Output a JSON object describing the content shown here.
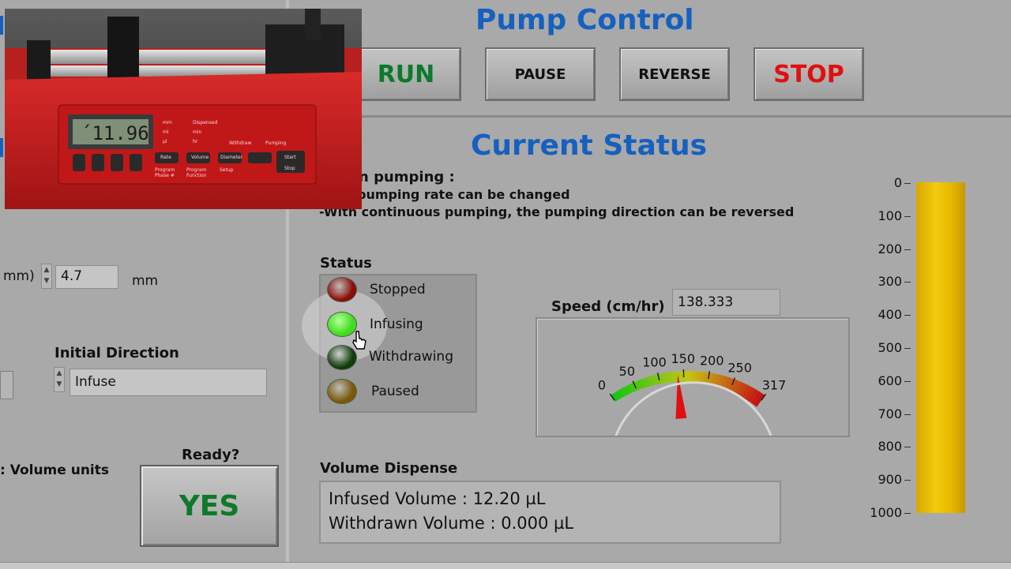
{
  "left": {
    "diameter_unit_fragment": "mm)",
    "diameter_value": "4.7",
    "diameter_unit": "mm",
    "initial_direction_label": "Initial Direction",
    "initial_direction_value": "Infuse",
    "volume_units_fragment": ": Volume units",
    "ready_label": "Ready?",
    "yes_label": "YES"
  },
  "pump_control": {
    "title": "Pump Control",
    "run": "RUN",
    "pause": "PAUSE",
    "reverse": "REVERSE",
    "stop": "STOP"
  },
  "status": {
    "title": "Current Status",
    "note_line1": "n pumping :",
    "note_line2": "pumping rate can be changed",
    "note_line3": "-With continuous pumping, the pumping direction can be reversed",
    "status_label": "Status",
    "leds": [
      {
        "label": "Stopped",
        "color": "#8a0e06",
        "on": false
      },
      {
        "label": "Infusing",
        "color": "#3fdc1c",
        "on": true
      },
      {
        "label": "Withdrawing",
        "color": "#0f3d0a",
        "on": false
      },
      {
        "label": "Paused",
        "color": "#7a5a08",
        "on": false
      }
    ],
    "speed_label": "Speed (cm/hr)",
    "speed_value": "138.333",
    "gauge": {
      "min": 0,
      "max": 317,
      "value": 138.333,
      "ticks": [
        "0",
        "50",
        "100",
        "150",
        "200",
        "250",
        "317"
      ]
    },
    "volume_dispense_label": "Volume Dispense",
    "infused_volume": "Infused Volume : 12.20 µL",
    "withdrawn_volume": "Withdrawn Volume : 0.000 µL",
    "tank": {
      "scale": [
        "0",
        "100",
        "200",
        "300",
        "400",
        "500",
        "600",
        "700",
        "800",
        "900",
        "1000"
      ],
      "level_fraction": 1.0,
      "fill_color": "#e9bd0a"
    }
  },
  "photo": {
    "display_reading": "11.96",
    "labels": [
      "mm",
      "Dispensed",
      "ml",
      "min",
      "µl",
      "hr",
      "Withdraw",
      "Pumping",
      "Rate",
      "Volume",
      "Diameter",
      "Start",
      "Stop",
      "Program Phase #",
      "Program Function",
      "Setup"
    ]
  }
}
